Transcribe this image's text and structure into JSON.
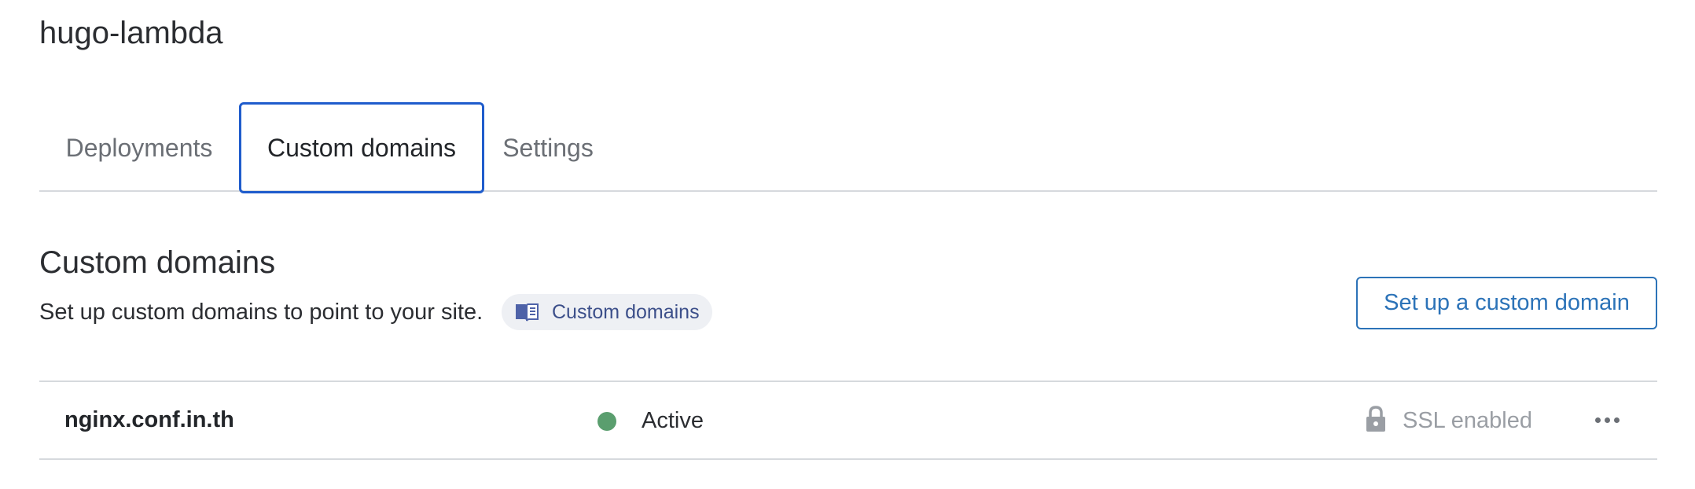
{
  "project": {
    "title": "hugo-lambda"
  },
  "tabs": [
    {
      "label": "Deployments",
      "selected": false
    },
    {
      "label": "Custom domains",
      "selected": true
    },
    {
      "label": "Settings",
      "selected": false
    }
  ],
  "section": {
    "title": "Custom domains",
    "description": "Set up custom domains to point to your site.",
    "doc_link": {
      "label": "Custom domains",
      "icon": "book-icon"
    },
    "setup_button_label": "Set up a custom domain"
  },
  "domains": [
    {
      "name": "nginx.conf.in.th",
      "status": "Active",
      "status_color": "#5a9e6e",
      "ssl": "SSL enabled"
    }
  ],
  "colors": {
    "accent": "#1f5ccc",
    "link": "#2c73b8",
    "muted": "#9a9ea4"
  }
}
